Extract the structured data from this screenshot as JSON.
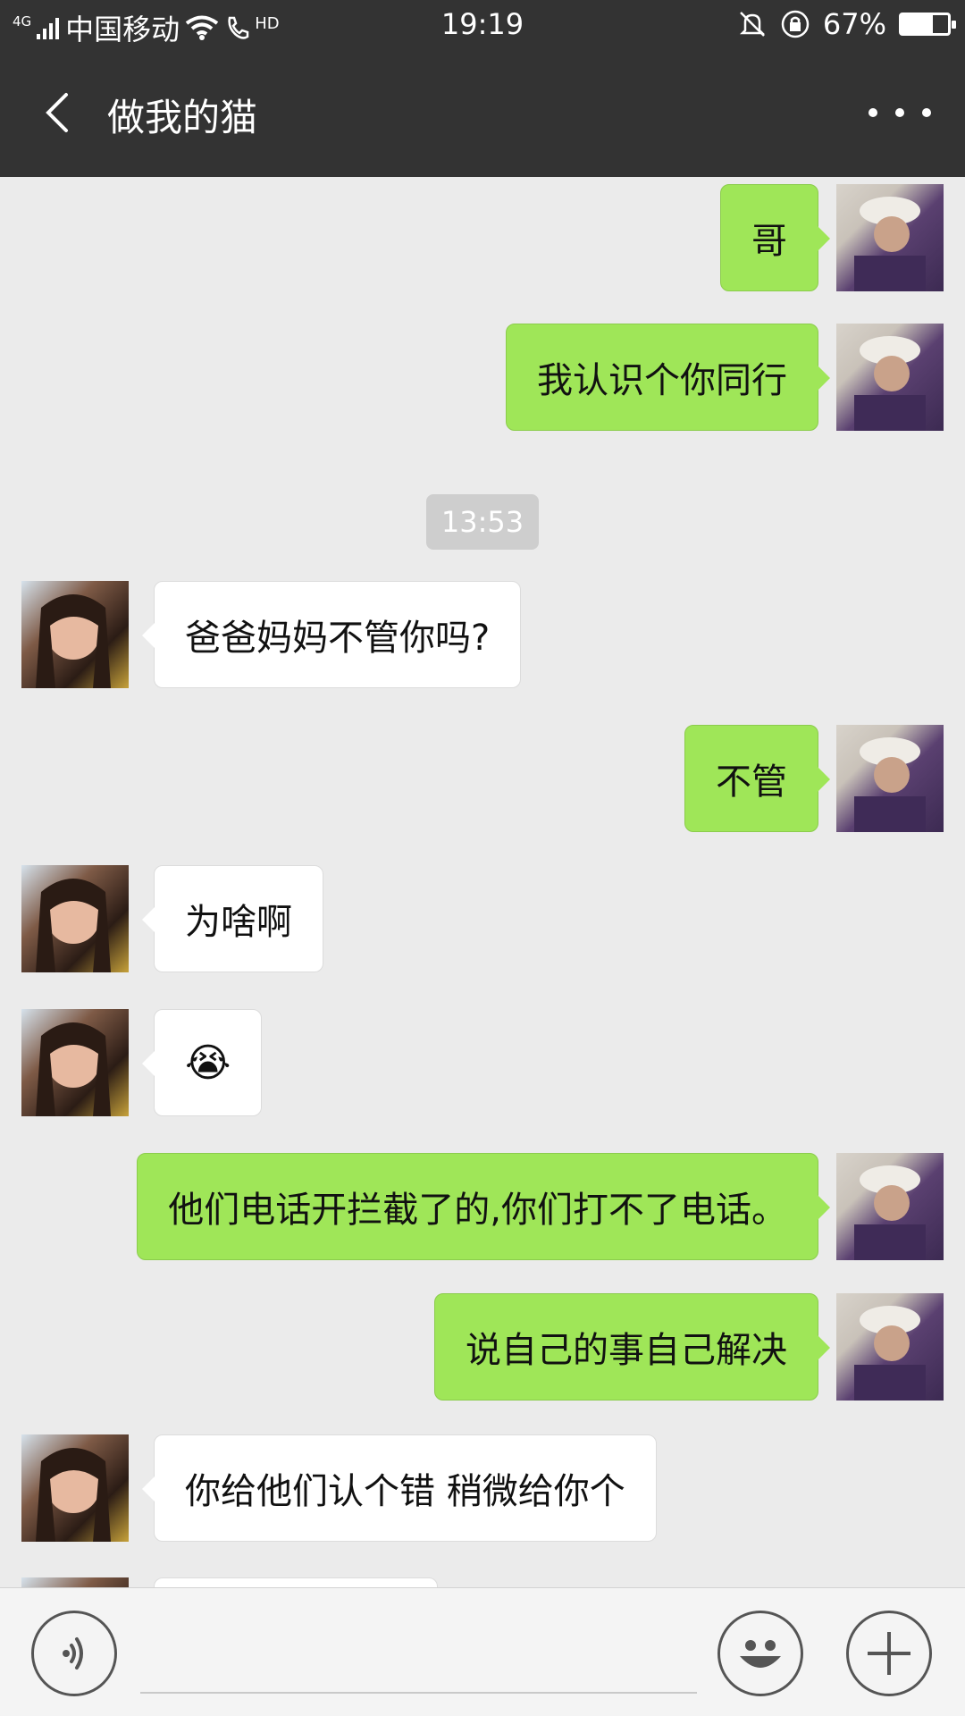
{
  "status_bar": {
    "network": "4G",
    "carrier": "中国移动",
    "hd": "HD",
    "time": "19:19",
    "battery_percent": "67%",
    "battery_level": 0.67
  },
  "header": {
    "title": "做我的猫",
    "back_icon": "chevron-left-icon",
    "more_icon": "ellipsis-icon"
  },
  "chat": {
    "timestamp": "13:53",
    "messages": [
      {
        "from": "me",
        "text": "哥"
      },
      {
        "from": "me",
        "text": "我认识个你同行"
      },
      {
        "from": "her",
        "text": "爸爸妈妈不管你吗?"
      },
      {
        "from": "me",
        "text": "不管"
      },
      {
        "from": "her",
        "text": "为啥啊"
      },
      {
        "from": "her",
        "text": "😭"
      },
      {
        "from": "me",
        "text": "他们电话开拦截了的,你们打不了电话。"
      },
      {
        "from": "me",
        "text": "说自己的事自己解决"
      },
      {
        "from": "her",
        "text": "你给他们认个错  稍微给你个"
      }
    ]
  },
  "input_bar": {
    "voice_icon": "voice-icon",
    "emoji_icon": "smiley-icon",
    "plus_icon": "plus-icon"
  },
  "colors": {
    "header_bg": "#333333",
    "chat_bg": "#ebebeb",
    "my_bubble": "#9fe658",
    "her_bubble": "#ffffff"
  }
}
